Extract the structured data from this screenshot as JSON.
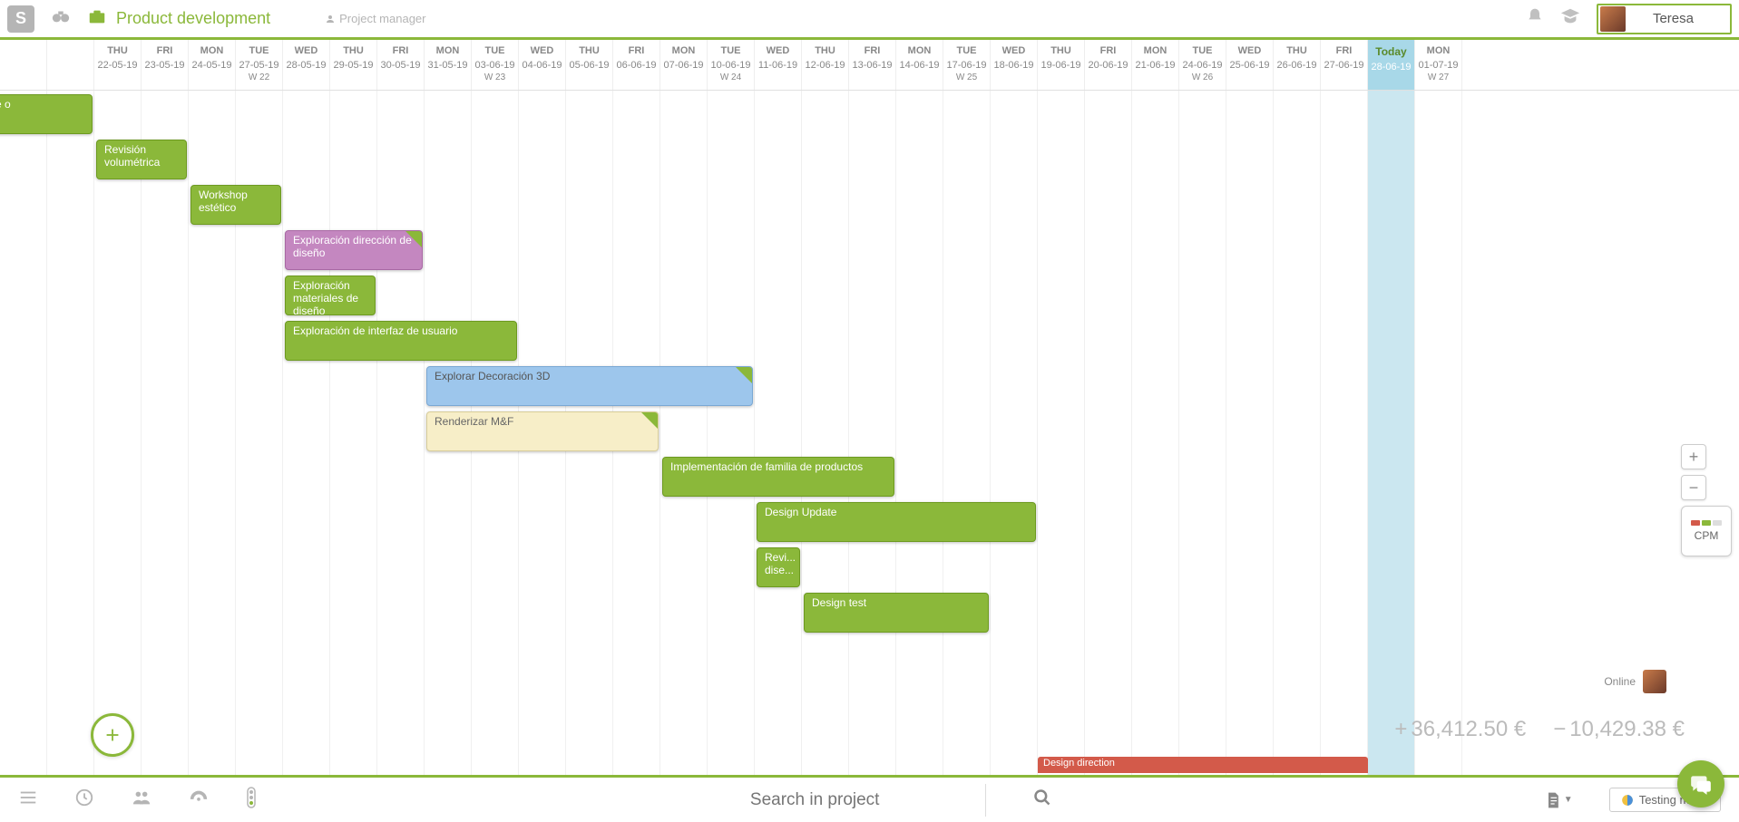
{
  "header": {
    "logo_letter": "S",
    "title": "Product development",
    "role": "Project manager",
    "user_name": "Teresa"
  },
  "timeline": {
    "today_label": "Today",
    "columns": [
      {
        "dow": "",
        "date": "",
        "wk": ""
      },
      {
        "dow": "",
        "date": "",
        "wk": ""
      },
      {
        "dow": "THU",
        "date": "22-05-19",
        "wk": ""
      },
      {
        "dow": "FRI",
        "date": "23-05-19",
        "wk": ""
      },
      {
        "dow": "MON",
        "date": "24-05-19",
        "wk": ""
      },
      {
        "dow": "TUE",
        "date": "27-05-19",
        "wk": "W 22"
      },
      {
        "dow": "WED",
        "date": "28-05-19",
        "wk": ""
      },
      {
        "dow": "THU",
        "date": "29-05-19",
        "wk": ""
      },
      {
        "dow": "FRI",
        "date": "30-05-19",
        "wk": ""
      },
      {
        "dow": "MON",
        "date": "31-05-19",
        "wk": ""
      },
      {
        "dow": "TUE",
        "date": "03-06-19",
        "wk": "W 23"
      },
      {
        "dow": "WED",
        "date": "04-06-19",
        "wk": ""
      },
      {
        "dow": "THU",
        "date": "05-06-19",
        "wk": ""
      },
      {
        "dow": "FRI",
        "date": "06-06-19",
        "wk": ""
      },
      {
        "dow": "MON",
        "date": "07-06-19",
        "wk": ""
      },
      {
        "dow": "TUE",
        "date": "10-06-19",
        "wk": "W 24"
      },
      {
        "dow": "WED",
        "date": "11-06-19",
        "wk": ""
      },
      {
        "dow": "THU",
        "date": "12-06-19",
        "wk": ""
      },
      {
        "dow": "FRI",
        "date": "13-06-19",
        "wk": ""
      },
      {
        "dow": "MON",
        "date": "14-06-19",
        "wk": ""
      },
      {
        "dow": "TUE",
        "date": "17-06-19",
        "wk": "W 25"
      },
      {
        "dow": "WED",
        "date": "18-06-19",
        "wk": ""
      },
      {
        "dow": "THU",
        "date": "19-06-19",
        "wk": ""
      },
      {
        "dow": "FRI",
        "date": "20-06-19",
        "wk": ""
      },
      {
        "dow": "MON",
        "date": "21-06-19",
        "wk": ""
      },
      {
        "dow": "TUE",
        "date": "24-06-19",
        "wk": "W 26"
      },
      {
        "dow": "WED",
        "date": "25-06-19",
        "wk": ""
      },
      {
        "dow": "THU",
        "date": "26-06-19",
        "wk": ""
      },
      {
        "dow": "FRI",
        "date": "27-06-19",
        "wk": ""
      },
      {
        "dow": "Today",
        "date": "28-06-19",
        "wk": "",
        "today": true
      },
      {
        "dow": "MON",
        "date": "01-07-19",
        "wk": "W 27"
      }
    ]
  },
  "tasks": [
    {
      "label": "shop de o",
      "cls": "green",
      "col": -1,
      "span": 3,
      "row": 0
    },
    {
      "label": "Revisión volumétrica",
      "cls": "green",
      "col": 2,
      "span": 2,
      "row": 1
    },
    {
      "label": "Workshop estético",
      "cls": "green",
      "col": 4,
      "span": 2,
      "row": 2
    },
    {
      "label": "Exploración dirección de diseño",
      "cls": "purple",
      "col": 6,
      "span": 3,
      "row": 3,
      "corner": true
    },
    {
      "label": "Exploración materiales de diseño",
      "cls": "green",
      "col": 6,
      "span": 2,
      "row": 4
    },
    {
      "label": "Exploración de interfaz de usuario",
      "cls": "green",
      "col": 6,
      "span": 5,
      "row": 5
    },
    {
      "label": "Explorar Decoración 3D",
      "cls": "blue",
      "col": 9,
      "span": 7,
      "row": 6,
      "corner": true
    },
    {
      "label": "Renderizar M&F",
      "cls": "cream",
      "col": 9,
      "span": 5,
      "row": 7,
      "corner": true
    },
    {
      "label": "Implementación de familia de productos",
      "cls": "green",
      "col": 14,
      "span": 5,
      "row": 8
    },
    {
      "label": "Design Update",
      "cls": "green",
      "col": 16,
      "span": 6,
      "row": 9
    },
    {
      "label": "Revi... dise...",
      "cls": "green",
      "col": 16,
      "span": 1,
      "row": 10
    },
    {
      "label": "Design test",
      "cls": "green",
      "col": 17,
      "span": 4,
      "row": 11
    }
  ],
  "red_bar": {
    "label": "Design direction",
    "col": 22,
    "span": 7
  },
  "totals": {
    "income": "36,412.50 €",
    "expense": "10,429.38 €"
  },
  "online": {
    "label": "Online"
  },
  "cpm": {
    "label": "CPM"
  },
  "footer": {
    "search_placeholder": "Search in project",
    "testing_mode": "Testing mode"
  }
}
